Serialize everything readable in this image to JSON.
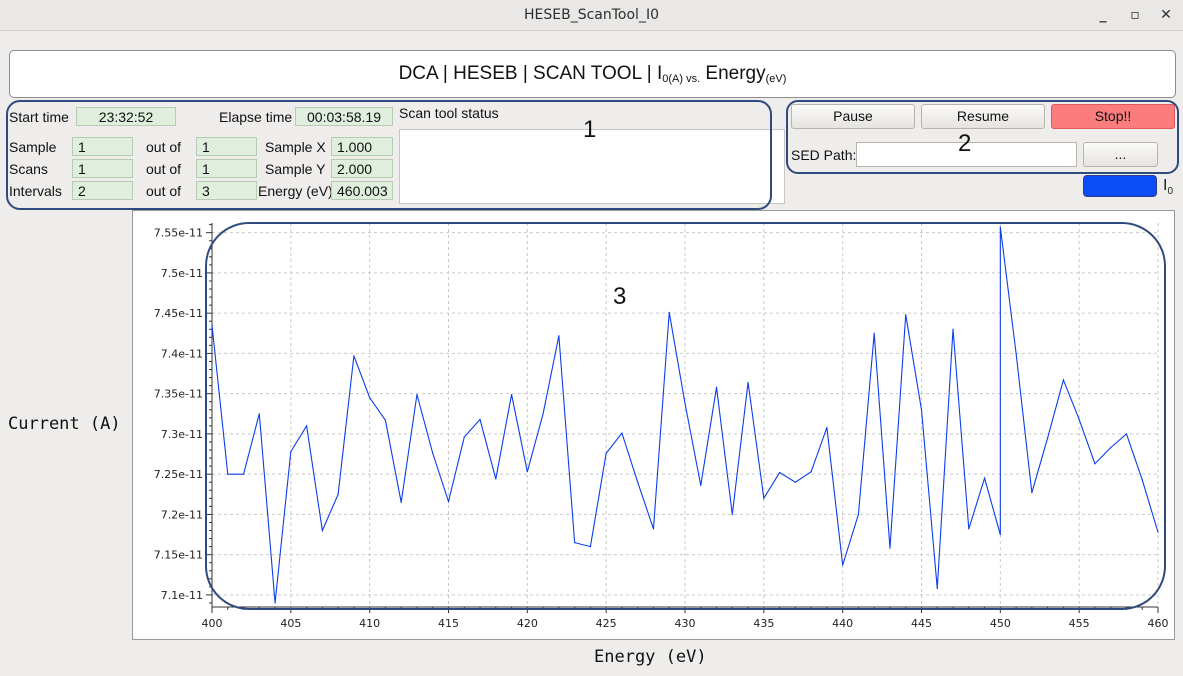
{
  "window": {
    "title": "HESEB_ScanTool_I0",
    "minimize_glyph": "_",
    "maximize_glyph": "▫",
    "close_glyph": "✕"
  },
  "banner": {
    "prefix": "DCA | HESEB | SCAN TOOL | I",
    "sub1": "0(A) vs.",
    "mid": " Energy",
    "sub2": "(eV)"
  },
  "info": {
    "start_time_label": "Start time",
    "start_time": "23:32:52",
    "elapse_time_label": "Elapse time",
    "elapse_time": "00:03:58.19",
    "status_label": "Scan tool status",
    "status_text": "",
    "sample_label": "Sample",
    "sample": "1",
    "sample_out_of_label": "out of",
    "sample_total": "1",
    "scans_label": "Scans",
    "scans": "1",
    "scans_out_of_label": "out of",
    "scans_total": "1",
    "intervals_label": "Intervals",
    "intervals": "2",
    "intervals_out_of_label": "out of",
    "intervals_total": "3",
    "sample_x_label": "Sample X",
    "sample_x": "1.000",
    "sample_y_label": "Sample Y",
    "sample_y": "2.000",
    "energy_label": "Energy (eV)",
    "energy": "460.003"
  },
  "controls": {
    "pause": "Pause",
    "resume": "Resume",
    "stop": "Stop!!",
    "sed_path_label": "SED Path:",
    "sed_path_value": "",
    "browse": "..."
  },
  "legend": {
    "label": "I",
    "label_sub": "0",
    "color": "#0d4df7"
  },
  "annotations": {
    "a1": "1",
    "a2": "2",
    "a3": "3"
  },
  "colors": {
    "line": "#0b3df0",
    "stop": "#fb7c7c",
    "frame": "#2f4a7c"
  },
  "chart_data": {
    "type": "line",
    "xlabel": "Energy (eV)",
    "ylabel": "Current (A)",
    "xlim": [
      400,
      460
    ],
    "ylim": [
      7.085e-11,
      7.562e-11
    ],
    "grid": true,
    "xticks": [
      400,
      405,
      410,
      415,
      420,
      425,
      430,
      435,
      440,
      445,
      450,
      455,
      460
    ],
    "xtick_labels": [
      "400",
      "405",
      "410",
      "415",
      "420",
      "425",
      "430",
      "435",
      "440",
      "445",
      "450",
      "455",
      "460"
    ],
    "yticks": [
      7.1e-11,
      7.15e-11,
      7.2e-11,
      7.25e-11,
      7.3e-11,
      7.35e-11,
      7.4e-11,
      7.45e-11,
      7.5e-11,
      7.55e-11
    ],
    "ytick_labels": [
      "7.1e-11",
      "7.15e-11",
      "7.2e-11",
      "7.25e-11",
      "7.3e-11",
      "7.35e-11",
      "7.4e-11",
      "7.45e-11",
      "7.5e-11",
      "7.55e-11"
    ],
    "series": [
      {
        "color": "#0b3df0",
        "x": [
          400,
          401,
          402,
          403,
          404,
          405,
          406,
          407,
          408,
          409,
          410,
          411,
          412,
          413,
          414,
          415,
          416,
          417,
          418,
          419,
          420,
          421,
          422,
          423,
          424,
          425,
          426,
          427,
          428,
          429,
          430,
          431,
          432,
          433,
          434,
          435,
          436,
          437,
          438,
          439,
          440,
          441,
          442,
          443,
          444,
          445,
          446,
          447,
          448,
          449,
          450,
          450,
          451,
          452,
          453,
          454,
          455,
          456,
          457,
          458,
          459,
          460
        ],
        "y": [
          7.435e-11,
          7.25e-11,
          7.25e-11,
          7.325e-11,
          7.09e-11,
          7.278e-11,
          7.31e-11,
          7.18e-11,
          7.225e-11,
          7.397e-11,
          7.345e-11,
          7.317e-11,
          7.215e-11,
          7.349e-11,
          7.276e-11,
          7.216e-11,
          7.296e-11,
          7.318e-11,
          7.244e-11,
          7.349e-11,
          7.253e-11,
          7.325e-11,
          7.422e-11,
          7.165e-11,
          7.16e-11,
          7.276e-11,
          7.301e-11,
          7.24e-11,
          7.182e-11,
          7.451e-11,
          7.338e-11,
          7.236e-11,
          7.358e-11,
          7.2e-11,
          7.364e-11,
          7.22e-11,
          7.252e-11,
          7.24e-11,
          7.253e-11,
          7.308e-11,
          7.137e-11,
          7.2e-11,
          7.425e-11,
          7.158e-11,
          7.448e-11,
          7.33e-11,
          7.108e-11,
          7.43e-11,
          7.182e-11,
          7.245e-11,
          7.175e-11,
          7.557e-11,
          7.4e-11,
          7.227e-11,
          7.295e-11,
          7.367e-11,
          7.318e-11,
          7.263e-11,
          7.283e-11,
          7.3e-11,
          7.243e-11,
          7.178e-11
        ]
      }
    ]
  }
}
